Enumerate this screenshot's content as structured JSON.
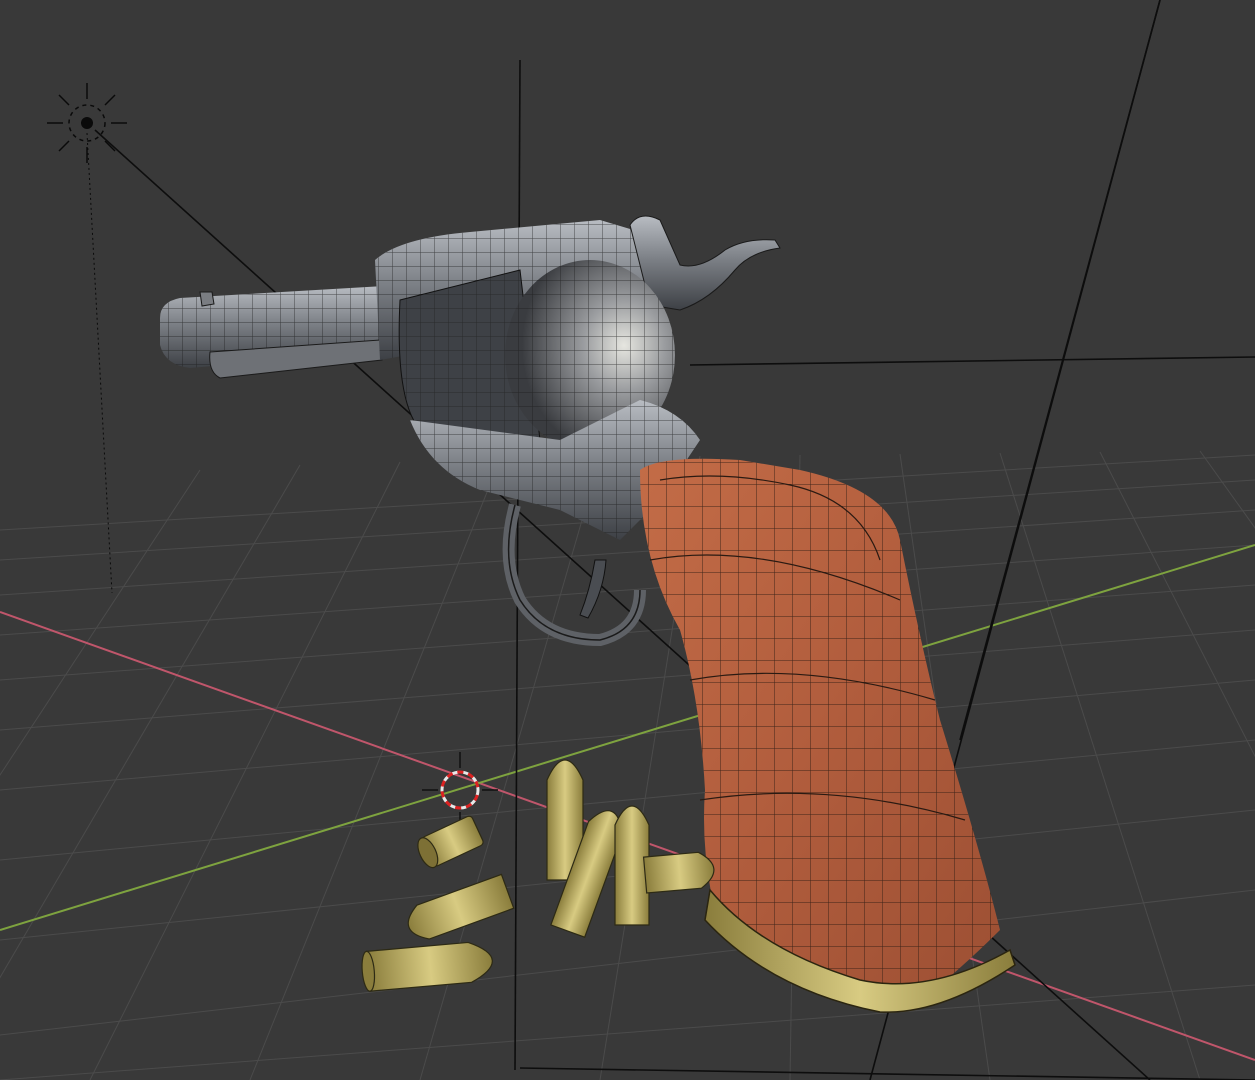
{
  "viewport": {
    "background_color": "#393939",
    "grid_color": "#4a4a4a",
    "x_axis_color": "#c0566b",
    "y_axis_color": "#7ea33f"
  },
  "scene": {
    "objects": [
      {
        "name": "revolver-frame",
        "material": "gunmetal",
        "color": "#8a8d92"
      },
      {
        "name": "revolver-grip",
        "material": "wood",
        "color": "#b5603f"
      },
      {
        "name": "grip-base-plate",
        "material": "brass",
        "color": "#c9b35a"
      },
      {
        "name": "bullets",
        "material": "brass",
        "color": "#c2b670"
      }
    ],
    "helpers": [
      {
        "name": "light-icon"
      },
      {
        "name": "3d-cursor-icon"
      },
      {
        "name": "camera-lines"
      }
    ]
  }
}
